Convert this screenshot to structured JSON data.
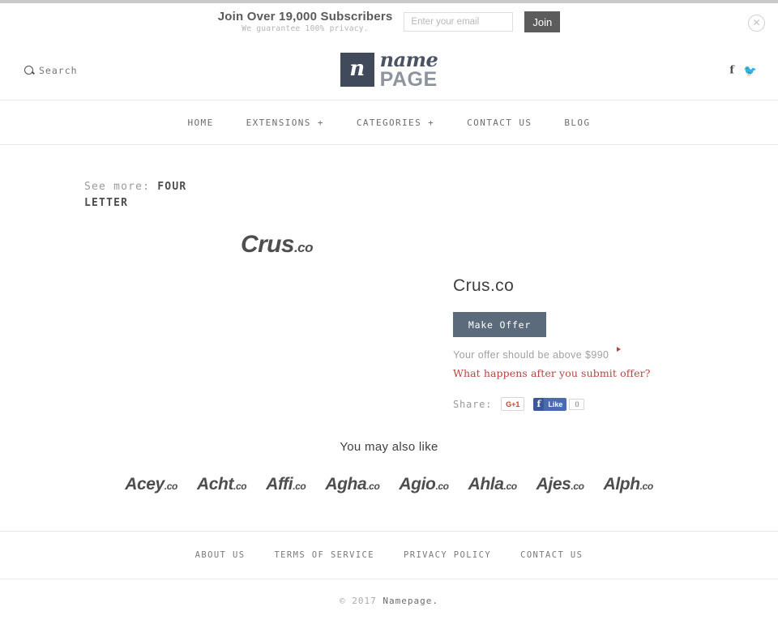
{
  "subscribe_bar": {
    "title": "Join Over 19,000 Subscribers",
    "subtitle": "We guarantee 100% privacy.",
    "email_placeholder": "Enter your email",
    "email_value": "",
    "join_label": "Join",
    "close_icon": "✕"
  },
  "header": {
    "search_label": "Search",
    "logo_mark_letter": "n",
    "logo_name": "name",
    "logo_page": "PAGE",
    "social": [
      {
        "name": "facebook",
        "glyph": "f"
      },
      {
        "name": "twitter",
        "glyph": "🐦"
      }
    ]
  },
  "nav": {
    "items": [
      {
        "label": "HOME"
      },
      {
        "label": "EXTENSIONS +"
      },
      {
        "label": "CATEGORIES +"
      },
      {
        "label": "CONTACT US"
      },
      {
        "label": "BLOG"
      }
    ]
  },
  "breadcrumb": {
    "prefix": "See more:",
    "category": "FOUR LETTER"
  },
  "product": {
    "logo_name": "Crus",
    "logo_tld": ".co",
    "title": "Crus.co",
    "make_offer_label": "Make Offer",
    "offer_note": "Your offer should be above $990",
    "offer_minimum": "$990",
    "offer_link": "What happens after you submit offer?",
    "share_label": "Share:",
    "gplus_label": "G+1",
    "fb_like_label": "Like",
    "fb_like_count": "0"
  },
  "also_like": {
    "title": "You may also like",
    "items": [
      {
        "name": "Acey",
        "tld": ".co"
      },
      {
        "name": "Acht",
        "tld": ".co"
      },
      {
        "name": "Affi",
        "tld": ".co"
      },
      {
        "name": "Agha",
        "tld": ".co"
      },
      {
        "name": "Agio",
        "tld": ".co"
      },
      {
        "name": "Ahla",
        "tld": ".co"
      },
      {
        "name": "Ajes",
        "tld": ".co"
      },
      {
        "name": "Alph",
        "tld": ".co"
      }
    ]
  },
  "footer": {
    "links": [
      {
        "label": "ABOUT US"
      },
      {
        "label": "TERMS OF SERVICE"
      },
      {
        "label": "PRIVACY POLICY"
      },
      {
        "label": "CONTACT US"
      }
    ],
    "copyright_prefix": "© 2017",
    "copyright_brand": "Namepage."
  },
  "colors": {
    "accent_button": "#5c6b7c",
    "join_button": "#5c5c5c",
    "logo_mark": "#404a5a",
    "link_red": "#b5443f",
    "facebook_blue": "#3b5998",
    "gplus_red": "#d6402f"
  }
}
